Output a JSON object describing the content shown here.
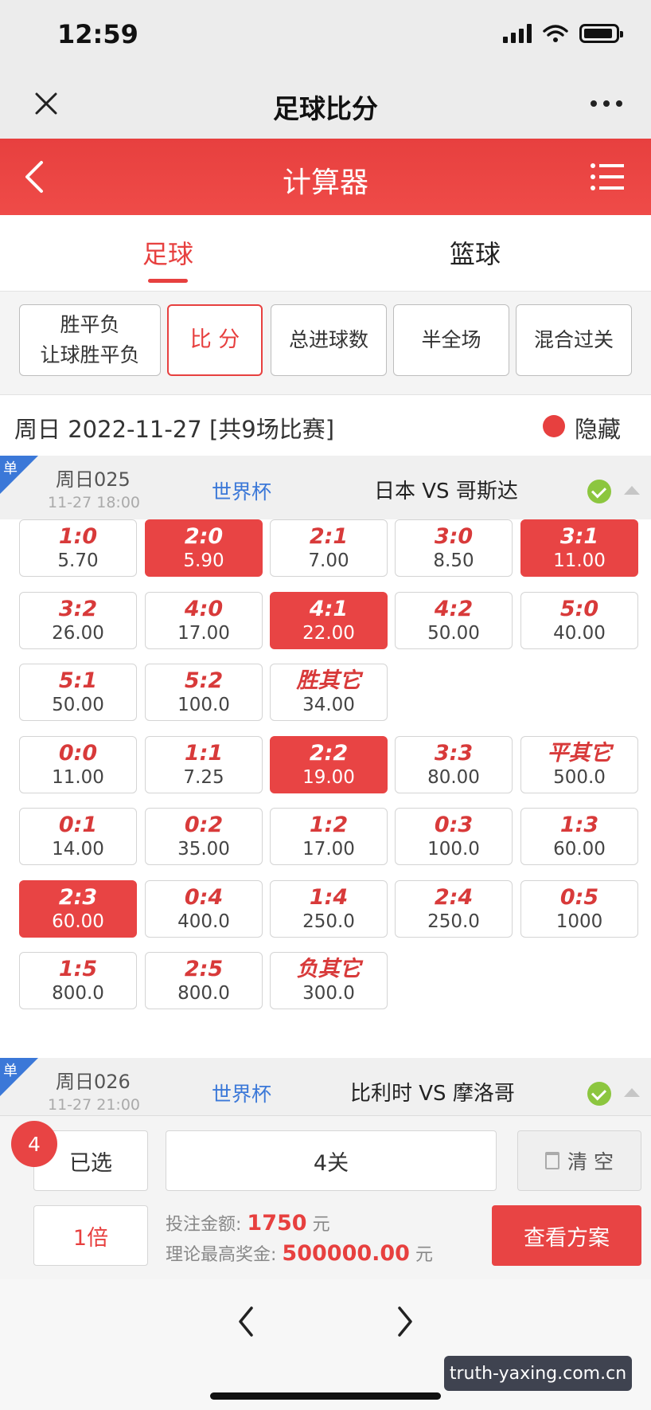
{
  "status_bar": {
    "time": "12:59"
  },
  "wechat_nav": {
    "title": "足球比分"
  },
  "header": {
    "title": "计算器"
  },
  "sport_tabs": [
    "足球",
    "篮球"
  ],
  "play_types": [
    {
      "lines": [
        "胜平负",
        "让球胜平负"
      ],
      "active": false
    },
    {
      "lines": [
        "比 分"
      ],
      "active": true
    },
    {
      "lines": [
        "总进球数"
      ],
      "active": false
    },
    {
      "lines": [
        "半全场"
      ],
      "active": false
    },
    {
      "lines": [
        "混合过关"
      ],
      "active": false
    }
  ],
  "date_row": {
    "text": "周日 2022-11-27 [共9场比赛]",
    "hide_label": "隐藏"
  },
  "matches": [
    {
      "tag": "单",
      "number": "周日025",
      "time": "11-27 18:00",
      "league": "世界杯",
      "teams": "日本 VS 哥斯达"
    },
    {
      "tag": "单",
      "number": "周日026",
      "time": "11-27 21:00",
      "league": "世界杯",
      "teams": "比利时 VS 摩洛哥"
    }
  ],
  "score_rows": [
    [
      {
        "score": "1:0",
        "odds": "5.70",
        "sel": false
      },
      {
        "score": "2:0",
        "odds": "5.90",
        "sel": true
      },
      {
        "score": "2:1",
        "odds": "7.00",
        "sel": false
      },
      {
        "score": "3:0",
        "odds": "8.50",
        "sel": false
      },
      {
        "score": "3:1",
        "odds": "11.00",
        "sel": true
      }
    ],
    [
      {
        "score": "3:2",
        "odds": "26.00",
        "sel": false
      },
      {
        "score": "4:0",
        "odds": "17.00",
        "sel": false
      },
      {
        "score": "4:1",
        "odds": "22.00",
        "sel": true
      },
      {
        "score": "4:2",
        "odds": "50.00",
        "sel": false
      },
      {
        "score": "5:0",
        "odds": "40.00",
        "sel": false
      }
    ],
    [
      {
        "score": "5:1",
        "odds": "50.00",
        "sel": false
      },
      {
        "score": "5:2",
        "odds": "100.0",
        "sel": false
      },
      {
        "score": "胜其它",
        "odds": "34.00",
        "sel": false
      }
    ],
    [
      {
        "score": "0:0",
        "odds": "11.00",
        "sel": false
      },
      {
        "score": "1:1",
        "odds": "7.25",
        "sel": false
      },
      {
        "score": "2:2",
        "odds": "19.00",
        "sel": true
      },
      {
        "score": "3:3",
        "odds": "80.00",
        "sel": false
      },
      {
        "score": "平其它",
        "odds": "500.0",
        "sel": false
      }
    ],
    [
      {
        "score": "0:1",
        "odds": "14.00",
        "sel": false
      },
      {
        "score": "0:2",
        "odds": "35.00",
        "sel": false
      },
      {
        "score": "1:2",
        "odds": "17.00",
        "sel": false
      },
      {
        "score": "0:3",
        "odds": "100.0",
        "sel": false
      },
      {
        "score": "1:3",
        "odds": "60.00",
        "sel": false
      }
    ],
    [
      {
        "score": "2:3",
        "odds": "60.00",
        "sel": true
      },
      {
        "score": "0:4",
        "odds": "400.0",
        "sel": false
      },
      {
        "score": "1:4",
        "odds": "250.0",
        "sel": false
      },
      {
        "score": "2:4",
        "odds": "250.0",
        "sel": false
      },
      {
        "score": "0:5",
        "odds": "1000",
        "sel": false
      }
    ],
    [
      {
        "score": "1:5",
        "odds": "800.0",
        "sel": false
      },
      {
        "score": "2:5",
        "odds": "800.0",
        "sel": false
      },
      {
        "score": "负其它",
        "odds": "300.0",
        "sel": false
      }
    ]
  ],
  "bottom": {
    "count": "4",
    "selected_label": "已选",
    "pass_label": "4关",
    "clear_label": "清 空",
    "multiple_label": "1倍",
    "bet_label": "投注金额:",
    "bet_value": "1750",
    "bet_unit": "元",
    "max_label": "理论最高奖金:",
    "max_value": "500000.00",
    "max_unit": "元",
    "view_label": "查看方案"
  },
  "watermark": "truth-yaxing.com.cn",
  "colors": {
    "accent": "#e84444",
    "league_blue": "#3b78d8",
    "check_green": "#8cc63f"
  }
}
